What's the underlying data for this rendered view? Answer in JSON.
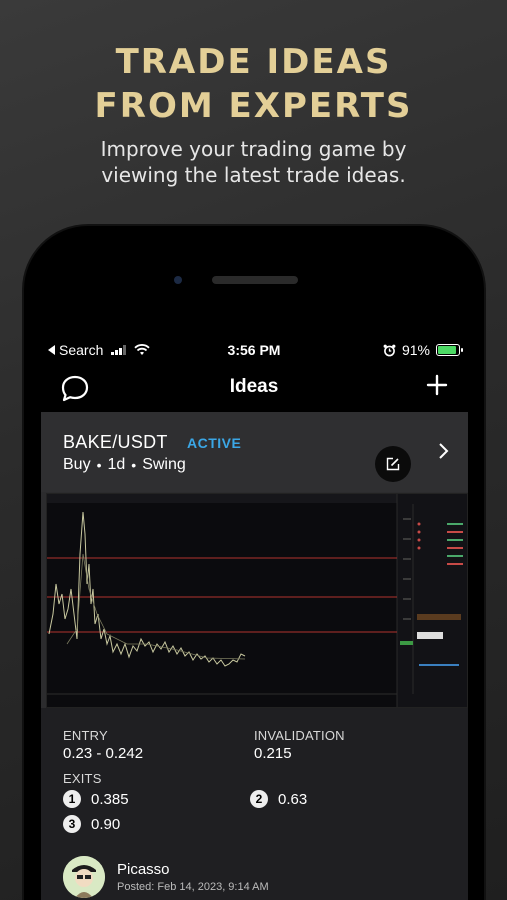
{
  "promo": {
    "title_line1": "TRADE IDEAS",
    "title_line2": "FROM EXPERTS",
    "subtitle_line1": "Improve your trading game by",
    "subtitle_line2": "viewing the latest trade ideas."
  },
  "status_bar": {
    "back_label": "Search",
    "time": "3:56 PM",
    "battery": "91%"
  },
  "nav": {
    "title": "Ideas",
    "left_icon": "chat-bubble-icon",
    "right_icon": "plus-icon"
  },
  "idea": {
    "pair": "BAKE/USDT",
    "status": "ACTIVE",
    "direction": "Buy",
    "timeframe": "1d",
    "style": "Swing",
    "entry_label": "ENTRY",
    "entry_value": "0.23 - 0.242",
    "invalidation_label": "INVALIDATION",
    "invalidation_value": "0.215",
    "exits_label": "EXITS",
    "exits": [
      {
        "num": "1",
        "value": "0.385"
      },
      {
        "num": "2",
        "value": "0.63"
      },
      {
        "num": "3",
        "value": "0.90"
      }
    ],
    "author_name": "Picasso",
    "posted": "Posted: Feb 14, 2023, 9:14 AM"
  },
  "colors": {
    "promo_gold": "#e3cf97",
    "active_blue": "#3ba7e6",
    "chart_line": "#c9c9a0",
    "level_red": "#b0332f"
  }
}
